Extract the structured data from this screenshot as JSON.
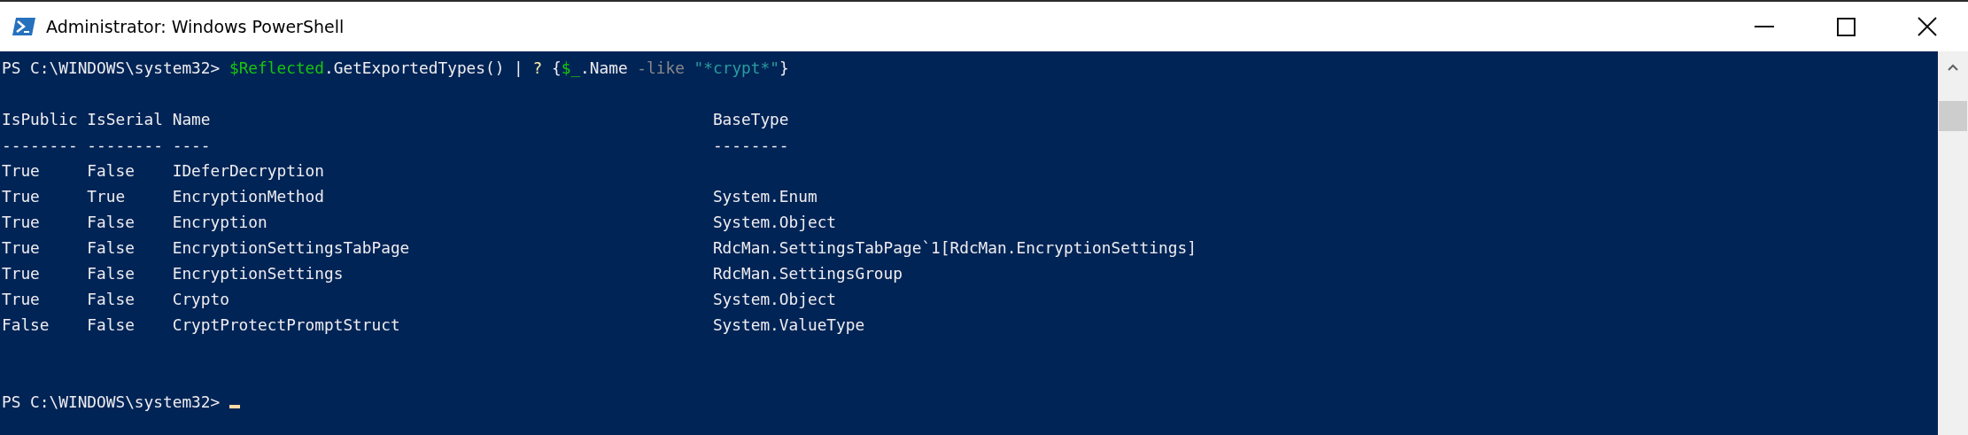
{
  "window": {
    "title": "Administrator: Windows PowerShell"
  },
  "console": {
    "prompt": "PS C:\\WINDOWS\\system32>",
    "command": [
      {
        "kind": "variable",
        "text": "$Reflected"
      },
      {
        "kind": "plain",
        "text": ".GetExportedTypes() | "
      },
      {
        "kind": "command",
        "text": "?"
      },
      {
        "kind": "plain",
        "text": " {"
      },
      {
        "kind": "variable",
        "text": "$_"
      },
      {
        "kind": "plain",
        "text": ".Name "
      },
      {
        "kind": "parameter",
        "text": "-like"
      },
      {
        "kind": "string",
        "text": " \"*crypt*\""
      },
      {
        "kind": "plain",
        "text": "}"
      }
    ],
    "table": {
      "columns": [
        "IsPublic",
        "IsSerial",
        "Name",
        "BaseType"
      ],
      "underlines": [
        "--------",
        "--------",
        "----",
        "--------"
      ],
      "rows": [
        [
          "True",
          "False",
          "IDeferDecryption",
          ""
        ],
        [
          "True",
          "True",
          "EncryptionMethod",
          "System.Enum"
        ],
        [
          "True",
          "False",
          "Encryption",
          "System.Object"
        ],
        [
          "True",
          "False",
          "EncryptionSettingsTabPage",
          "RdcMan.SettingsTabPage`1[RdcMan.EncryptionSettings]"
        ],
        [
          "True",
          "False",
          "EncryptionSettings",
          "RdcMan.SettingsGroup"
        ],
        [
          "True",
          "False",
          "Crypto",
          "System.Object"
        ],
        [
          "False",
          "False",
          "CryptProtectPromptStruct",
          "System.ValueType"
        ]
      ]
    },
    "final_prompt": "PS C:\\WINDOWS\\system32>"
  }
}
